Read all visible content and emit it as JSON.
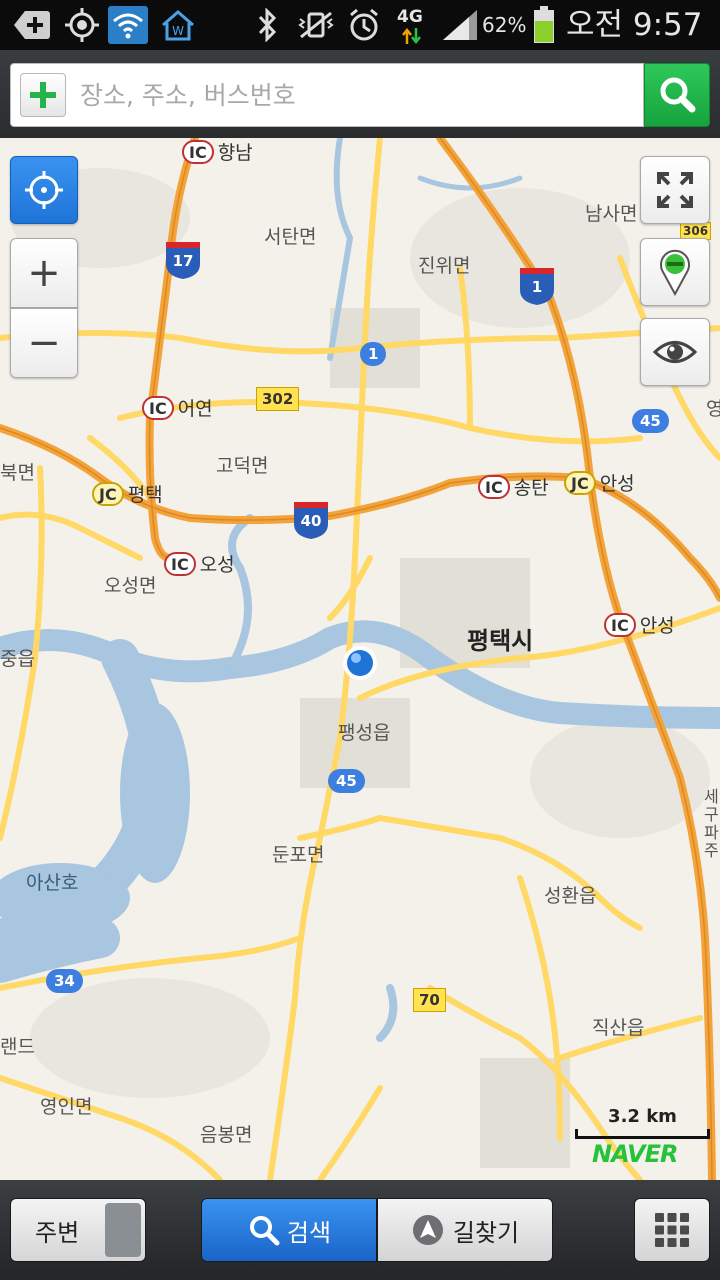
{
  "status_bar": {
    "battery": "62%",
    "network": "4G",
    "time": "오전 9:57",
    "icons": [
      "add-icon",
      "gps-icon",
      "wifi-icon",
      "home-icon",
      "bluetooth-icon",
      "vibrate-icon",
      "alarm-icon",
      "signal-icon",
      "battery-icon"
    ]
  },
  "search": {
    "placeholder": "장소, 주소, 버스번호",
    "value": "",
    "add_icon": "plus-icon",
    "search_icon": "magnifier-icon"
  },
  "map": {
    "place_labels": {
      "hyangnam": "향남",
      "seotan": "서탄면",
      "jinwi": "진위면",
      "namsa": "남사면",
      "eoyeon": "어연",
      "godeok": "고덕면",
      "bukmyeon": "북면",
      "pyeongtaek_jc": "평택",
      "songtan": "송탄",
      "anseong_jc": "안성",
      "oseong_ic": "오성",
      "oseong_myeon": "오성면",
      "pyeongtaek_si": "평택시",
      "anseong_ic": "안성",
      "jungeup": "중읍",
      "paengseong": "팽성읍",
      "dunpo": "둔포면",
      "asanho": "아산호",
      "seonghwan": "성환읍",
      "jiksan": "직산읍",
      "raendeu": "랜드",
      "yeongin": "영인면",
      "eumbong": "음봉면",
      "edge_right": "영",
      "edge_vertical": "세구파주"
    },
    "ic_badge": "IC",
    "jc_badge": "JC",
    "route_shields": {
      "r302": "302",
      "r1": "1",
      "r45a": "45",
      "r45b": "45",
      "r34": "34",
      "r70": "70",
      "r306": "306",
      "i17": "17",
      "i1": "1",
      "i40": "40"
    },
    "scale": "3.2 km",
    "logo": "NAVER",
    "colors": {
      "land": "#f3f1ea",
      "water": "#a8c6e0",
      "road": "#ffd866",
      "highway": "#f4a23a",
      "gps_blue": "#1f74d8"
    }
  },
  "controls": {
    "gps_icon": "crosshair-icon",
    "zoom_in": "+",
    "zoom_out": "−",
    "fullscreen_icon": "expand-icon",
    "pin_icon": "map-pin-icon",
    "view_icon": "eye-icon"
  },
  "bottom_bar": {
    "nearby": "주변",
    "search": "검색",
    "route": "길찾기",
    "menu_icon": "grid-icon"
  }
}
